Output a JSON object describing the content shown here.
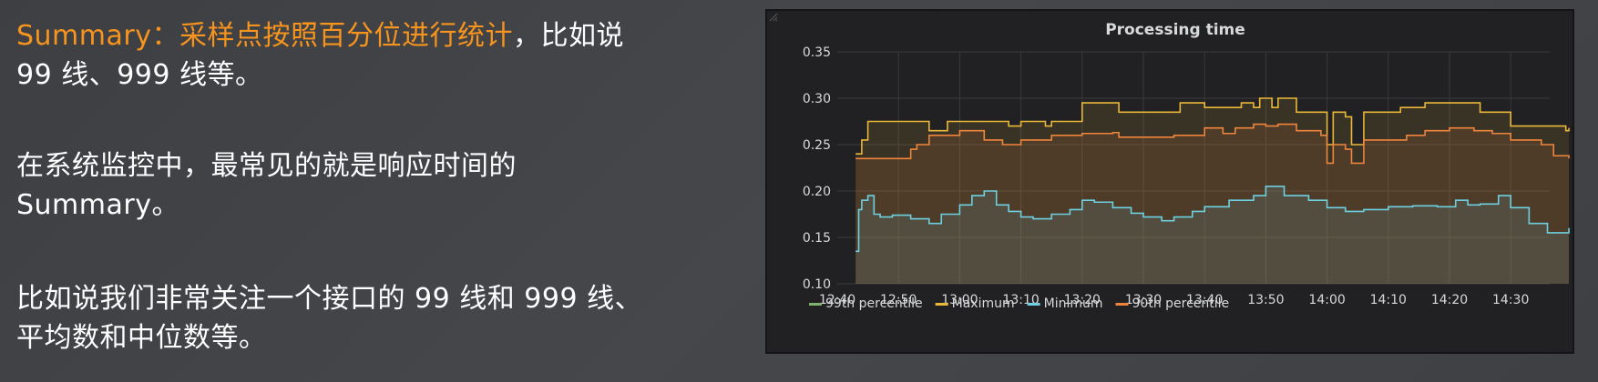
{
  "text": {
    "p1_accent": "Summary：采样点按照百分位进行统计",
    "p1_rest": "，比如说",
    "p1_line2": "99 线、999 线等。",
    "p2_line1": "在系统监控中，最常见的就是响应时间的",
    "p2_line2": "Summary。",
    "p3_line1": "比如说我们非常关注一个接口的 99 线和 999 线、",
    "p3_line2": "平均数和中位数等。"
  },
  "colors": {
    "accent": "#f7941d",
    "p99": "#7eb26d",
    "max": "#eab839",
    "min": "#6ed0e0",
    "p90": "#ef843c"
  },
  "chart_data": {
    "type": "line",
    "title": "Processing time",
    "x_ticks": [
      "12:40",
      "12:50",
      "13:00",
      "13:10",
      "13:20",
      "13:30",
      "13:40",
      "13:50",
      "14:00",
      "14:10",
      "14:20",
      "14:30"
    ],
    "x_start": "12:40",
    "ylim": [
      0.1,
      0.35
    ],
    "y_ticks": [
      "0.10",
      "0.15",
      "0.20",
      "0.25",
      "0.30",
      "0.35"
    ],
    "grid": true,
    "legend_position": "bottom-left",
    "series": [
      {
        "name": "99th percentile",
        "color": "#7eb26d",
        "x": [],
        "y": []
      },
      {
        "name": "Maximum",
        "color": "#eab839",
        "x": [
          "12:43",
          "12:44",
          "12:45",
          "12:47",
          "12:53",
          "12:55",
          "12:58",
          "13:00",
          "13:07",
          "13:08",
          "13:10",
          "13:14",
          "13:15",
          "13:18",
          "13:20",
          "13:25",
          "13:26",
          "13:30",
          "13:35",
          "13:36",
          "13:40",
          "13:44",
          "13:46",
          "13:48",
          "13:49",
          "13:50",
          "13:51",
          "13:52",
          "13:55",
          "13:59",
          "14:00",
          "14:01",
          "14:03",
          "14:04",
          "14:06",
          "14:10",
          "14:12",
          "14:16",
          "14:18",
          "14:20",
          "14:24",
          "14:25",
          "14:28",
          "14:30",
          "14:35",
          "14:39",
          "14:39.5"
        ],
        "y": [
          0.24,
          0.255,
          0.275,
          0.275,
          0.275,
          0.265,
          0.275,
          0.275,
          0.275,
          0.27,
          0.275,
          0.27,
          0.275,
          0.275,
          0.295,
          0.295,
          0.285,
          0.285,
          0.285,
          0.295,
          0.29,
          0.29,
          0.295,
          0.29,
          0.3,
          0.3,
          0.29,
          0.3,
          0.285,
          0.285,
          0.25,
          0.285,
          0.28,
          0.25,
          0.285,
          0.285,
          0.29,
          0.295,
          0.295,
          0.295,
          0.295,
          0.285,
          0.285,
          0.27,
          0.27,
          0.265,
          0.268
        ]
      },
      {
        "name": "Minimum",
        "color": "#6ed0e0",
        "x": [
          "12:43",
          "12:43.5",
          "12:44",
          "12:45",
          "12:46",
          "12:47",
          "12:49",
          "12:52",
          "12:55",
          "12:57",
          "13:00",
          "13:02",
          "13:04",
          "13:06",
          "13:08",
          "13:10",
          "13:12",
          "13:15",
          "13:18",
          "13:20",
          "13:22",
          "13:25",
          "13:28",
          "13:30",
          "13:33",
          "13:35",
          "13:38",
          "13:40",
          "13:44",
          "13:48",
          "13:50",
          "13:53",
          "13:57",
          "14:00",
          "14:03",
          "14:06",
          "14:10",
          "14:14",
          "14:18",
          "14:21",
          "14:23",
          "14:25",
          "14:28",
          "14:30",
          "14:33",
          "14:36",
          "14:39.5"
        ],
        "y": [
          0.135,
          0.18,
          0.19,
          0.195,
          0.175,
          0.172,
          0.174,
          0.17,
          0.165,
          0.175,
          0.185,
          0.195,
          0.2,
          0.185,
          0.178,
          0.172,
          0.17,
          0.175,
          0.18,
          0.19,
          0.188,
          0.182,
          0.176,
          0.172,
          0.168,
          0.172,
          0.178,
          0.183,
          0.19,
          0.195,
          0.205,
          0.195,
          0.19,
          0.182,
          0.178,
          0.18,
          0.183,
          0.184,
          0.183,
          0.19,
          0.185,
          0.186,
          0.195,
          0.182,
          0.165,
          0.155,
          0.16
        ]
      },
      {
        "name": "90th percentile",
        "color": "#ef843c",
        "x": [
          "12:43",
          "12:48",
          "12:52",
          "12:53",
          "12:55",
          "12:58",
          "13:00",
          "13:04",
          "13:07",
          "13:10",
          "13:15",
          "13:20",
          "13:25",
          "13:26",
          "13:30",
          "13:35",
          "13:40",
          "13:43",
          "13:45",
          "13:48",
          "13:50",
          "13:52",
          "13:55",
          "13:59",
          "14:00",
          "14:01",
          "14:03",
          "14:04",
          "14:06",
          "14:10",
          "14:13",
          "14:16",
          "14:20",
          "14:24",
          "14:27",
          "14:30",
          "14:35",
          "14:37",
          "14:39.5"
        ],
        "y": [
          0.235,
          0.235,
          0.245,
          0.25,
          0.26,
          0.26,
          0.265,
          0.255,
          0.25,
          0.255,
          0.26,
          0.262,
          0.263,
          0.258,
          0.258,
          0.26,
          0.268,
          0.262,
          0.268,
          0.272,
          0.27,
          0.272,
          0.265,
          0.26,
          0.23,
          0.25,
          0.245,
          0.23,
          0.255,
          0.255,
          0.26,
          0.265,
          0.268,
          0.265,
          0.262,
          0.255,
          0.25,
          0.238,
          0.235
        ]
      }
    ]
  }
}
